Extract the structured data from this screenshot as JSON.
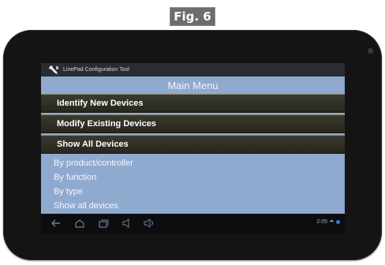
{
  "figure": {
    "label": "Fig. 6"
  },
  "app": {
    "title": "LinePad Configuration Tool",
    "icon": "wrench-icon"
  },
  "main_menu": {
    "title": "Main Menu",
    "buttons": [
      {
        "label": "Identify New Devices"
      },
      {
        "label": "Modify Existing Devices"
      },
      {
        "label": "Show All Devices"
      }
    ],
    "sub_options": [
      {
        "label": "By product/controller"
      },
      {
        "label": "By function"
      },
      {
        "label": "By type"
      },
      {
        "label": "Show all devices"
      }
    ]
  },
  "navbar": {
    "icons": [
      "back-icon",
      "home-icon",
      "recent-apps-icon",
      "volume-down-icon",
      "volume-up-icon"
    ],
    "time": "2:05",
    "status_icons": [
      "wifi-icon",
      "battery-icon"
    ]
  },
  "colors": {
    "content_bg": "#8fa9cf",
    "button_bg": "#2e2e24",
    "tablet_bezel": "#141414",
    "titlebar_bg": "#2a2c31"
  }
}
